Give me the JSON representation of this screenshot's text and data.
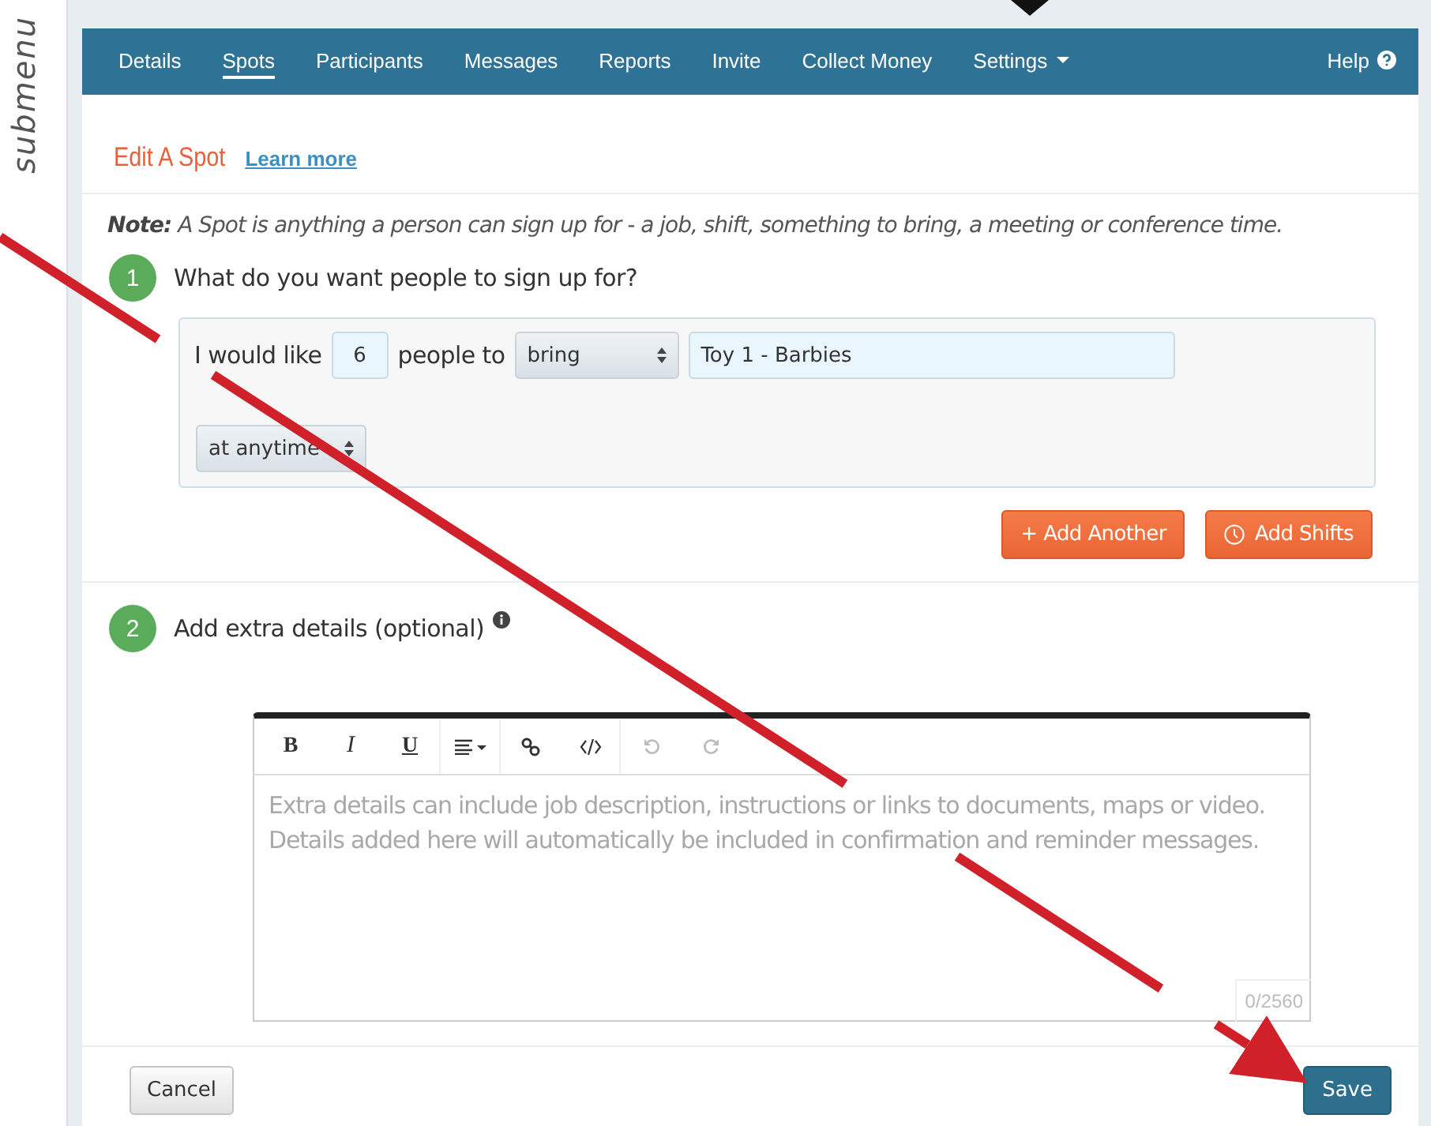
{
  "annotation": {
    "label": "submenu"
  },
  "nav": {
    "items": [
      {
        "label": "Details",
        "selected": false
      },
      {
        "label": "Spots",
        "selected": true
      },
      {
        "label": "Participants",
        "selected": false
      },
      {
        "label": "Messages",
        "selected": false
      },
      {
        "label": "Reports",
        "selected": false
      },
      {
        "label": "Invite",
        "selected": false
      },
      {
        "label": "Collect Money",
        "selected": false
      },
      {
        "label": "Settings",
        "selected": false,
        "dropdown": true
      }
    ],
    "help": "Help"
  },
  "header": {
    "title": "Edit A Spot",
    "link": "Learn more"
  },
  "note": "**Note:** A Spot is anything a person can sign up for - a job, shift, something to bring, a meeting or conference time.",
  "step1": {
    "number": "1",
    "question": "What do you want people to sign up for?",
    "prefix": "I would like",
    "count": "6",
    "middle": "people to",
    "verb": "bring",
    "item": "Toy 1 - Barbies",
    "timing": "at anytime"
  },
  "buttons": [
    {
      "label": "+ Add Another",
      "kind": "plain"
    },
    {
      "label": "Add Shifts",
      "kind": "clock"
    }
  ],
  "step2": {
    "number": "2",
    "question": "Add extra details (optional)"
  },
  "toolbar": [
    {
      "kind": "bold",
      "label": "B",
      "disabled": false
    },
    {
      "kind": "italic",
      "label": "I",
      "disabled": false
    },
    {
      "kind": "underline",
      "label": "U",
      "disabled": false
    },
    {
      "kind": "align",
      "disabled": false
    },
    {
      "kind": "link",
      "disabled": false
    },
    {
      "kind": "code",
      "disabled": false
    },
    {
      "kind": "undo",
      "disabled": true
    },
    {
      "kind": "redo",
      "disabled": true
    }
  ],
  "editor": {
    "placeholder": "Extra details can include job description, instructions or links to documents, maps or video.\nDetails added here will automatically be included in confirmation and reminder messages.",
    "counter": "0/2560"
  },
  "footer": {
    "cancel": "Cancel",
    "save": "Save"
  }
}
